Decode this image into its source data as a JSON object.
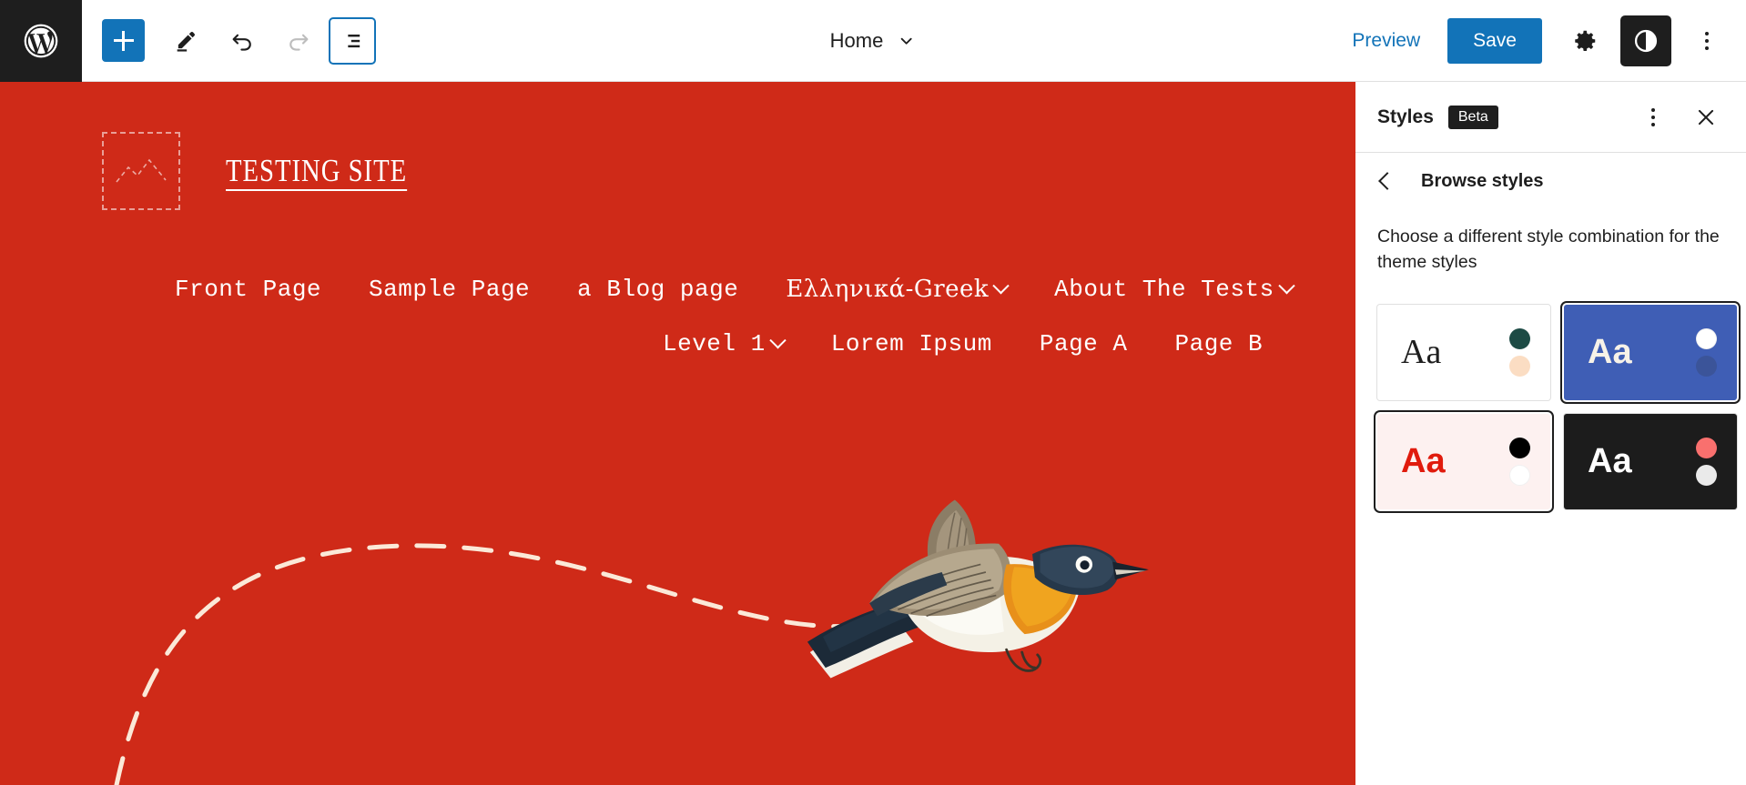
{
  "topbar": {
    "wp_logo_label": "W",
    "inserter_label": "Toggle block inserter",
    "tools_label": "Tools",
    "undo_label": "Undo",
    "redo_label": "Redo",
    "listview_label": "Document Overview",
    "document_title": "Home",
    "preview_label": "Preview",
    "save_label": "Save",
    "settings_label": "Settings",
    "styles_label": "Styles",
    "options_label": "Options"
  },
  "canvas": {
    "background_color": "#cf2a18",
    "text_color": "#ffffff",
    "site_title": "TESTING SITE",
    "logo_placeholder_label": "Site Logo placeholder",
    "nav_primary": [
      {
        "label": "Front Page",
        "has_submenu": false
      },
      {
        "label": "Sample Page",
        "has_submenu": false
      },
      {
        "label": "a Blog page",
        "has_submenu": false
      },
      {
        "label": "Ελληνικά-Greek",
        "has_submenu": true
      },
      {
        "label": "About The Tests",
        "has_submenu": true
      }
    ],
    "nav_secondary": [
      {
        "label": "Level 1",
        "has_submenu": true
      },
      {
        "label": "Lorem Ipsum",
        "has_submenu": false
      },
      {
        "label": "Page A",
        "has_submenu": false
      },
      {
        "label": "Page B",
        "has_submenu": false
      }
    ],
    "decoration": {
      "flight_path_label": "dashed flight path",
      "bird_label": "flying bird illustration"
    }
  },
  "sidebar": {
    "title": "Styles",
    "badge": "Beta",
    "more_label": "More",
    "close_label": "Close Styles",
    "back_label": "Back",
    "section_title": "Browse styles",
    "description": "Choose a different style combination for the theme styles",
    "variations": [
      {
        "name": "default-style",
        "sample_text": "Aa",
        "bg": "#ffffff",
        "fg": "#1e1e1e",
        "font": "serif",
        "dot1": "#1d4b45",
        "dot2": "#fbddc3",
        "selected": false
      },
      {
        "name": "blue-style",
        "sample_text": "Aa",
        "bg": "#3f5eb5",
        "fg": "#f7f2e8",
        "font": "sans",
        "dot1": "#ffffff",
        "dot2": "#3b5499",
        "selected": true
      },
      {
        "name": "pink-red-style",
        "sample_text": "Aa",
        "bg": "#fdf1f0",
        "fg": "#e01b0d",
        "font": "sans",
        "dot1": "#000000",
        "dot2": "#ffffff",
        "selected": true
      },
      {
        "name": "dark-style",
        "sample_text": "Aa",
        "bg": "#1c1c1c",
        "fg": "#ffffff",
        "font": "sans",
        "dot1": "#f9706e",
        "dot2": "#eaeaea",
        "selected": false
      }
    ]
  }
}
